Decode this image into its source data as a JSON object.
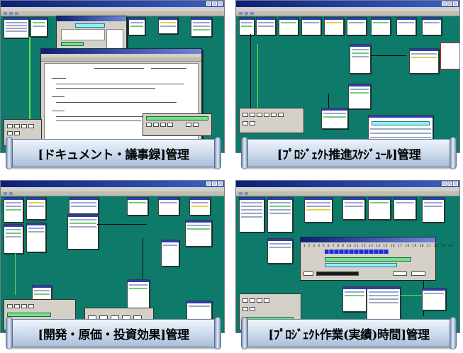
{
  "panels": [
    {
      "id": "documents",
      "caption": "[ドキュメント・議事録]管理"
    },
    {
      "id": "schedule",
      "caption": "[ﾌﾟﾛｼﾞｪｸﾄ推進ｽｹｼﾞｭｰﾙ]管理"
    },
    {
      "id": "cost",
      "caption": "[開発・原価・投資効果]管理"
    },
    {
      "id": "worktime",
      "caption": "[ﾌﾟﾛｼﾞｪｸﾄ作業(実績)時間]管理"
    }
  ],
  "colors": {
    "workspace": "#0e7a6a",
    "titlebar": "#0a1f7a",
    "banner": "#c7d7ea",
    "node_header": "#2a3fae",
    "timeline_block": "#1a2fd6"
  },
  "icons": [
    "window-minimize-icon",
    "window-maximize-icon",
    "window-close-icon"
  ]
}
